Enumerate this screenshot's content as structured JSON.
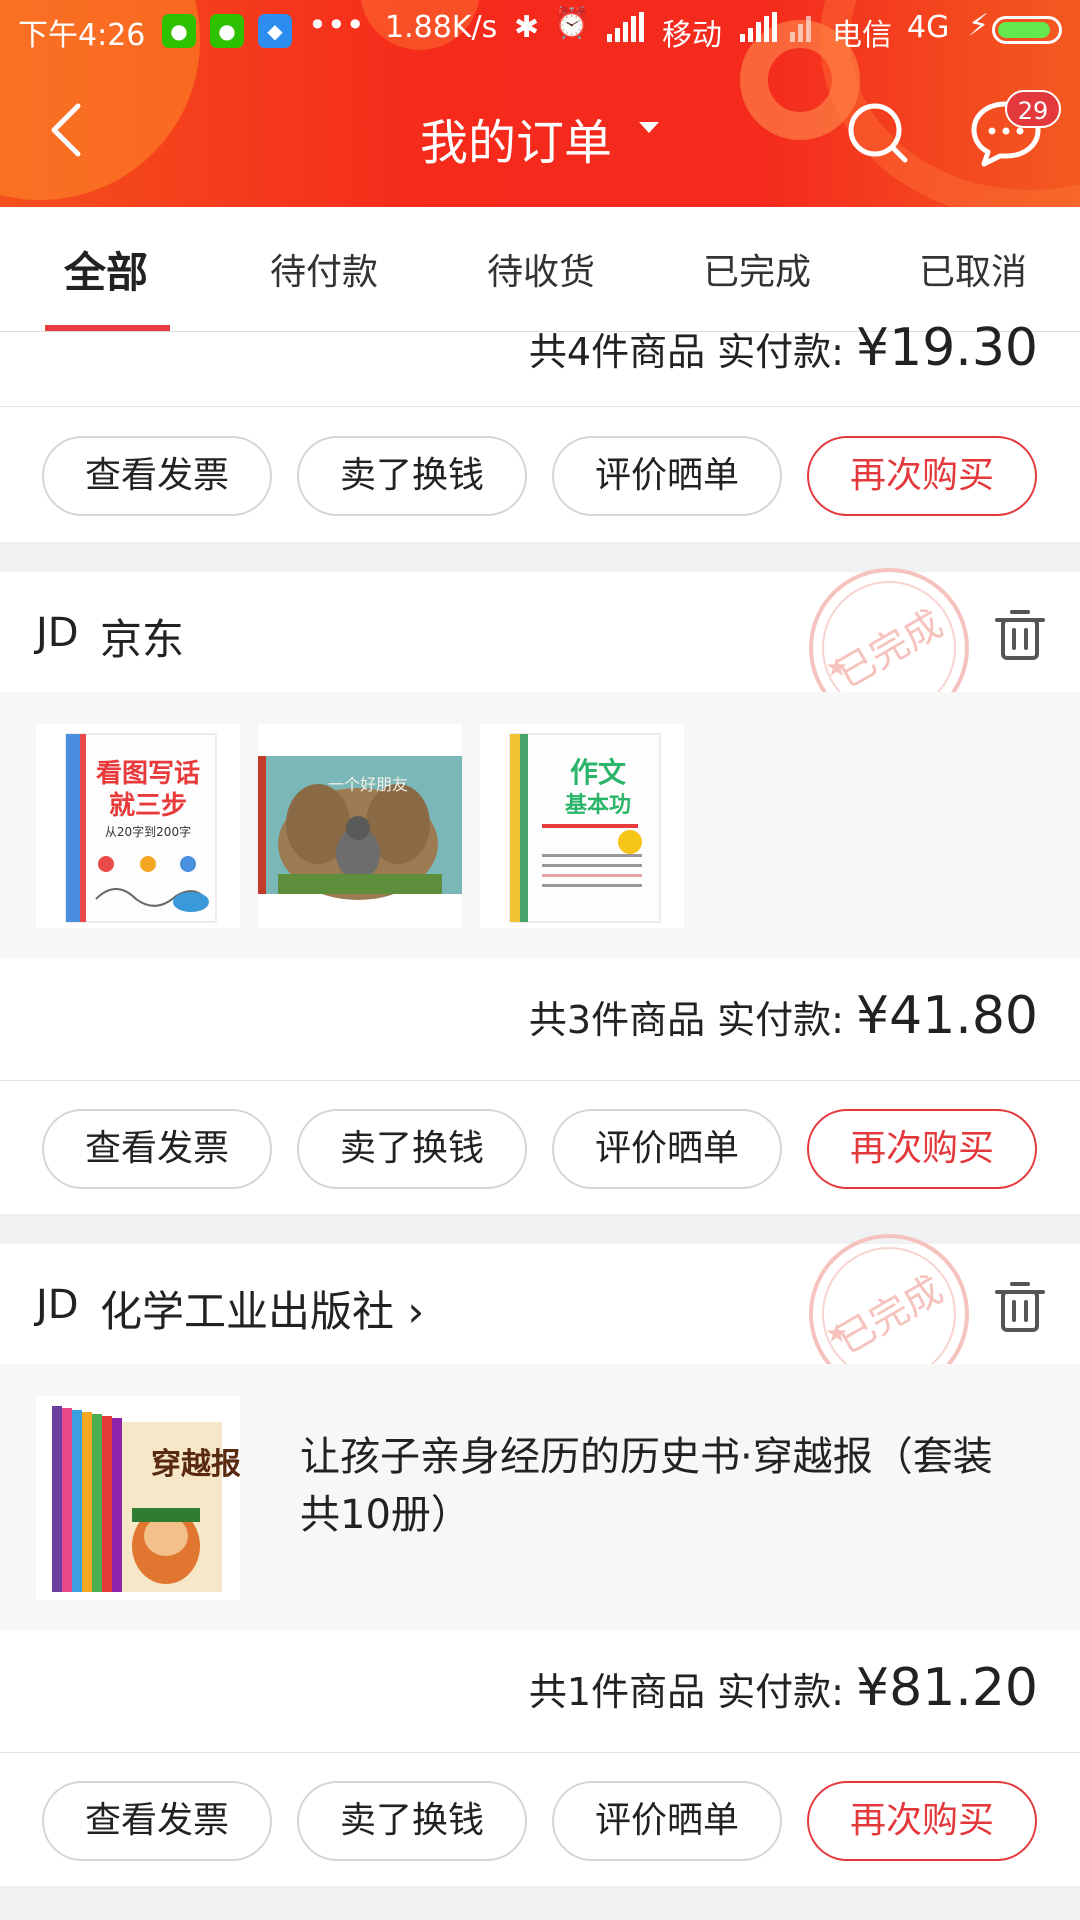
{
  "status_bar": {
    "time": "下午4:26",
    "speed": "1.88K/s",
    "carrier1": "移动",
    "carrier2": "电信",
    "network": "4G",
    "battery_level": 0.9,
    "battery_color": "#63e84e"
  },
  "header": {
    "title": "我的订单",
    "badge_count": "29",
    "accent_color": "#f42a1d"
  },
  "tabs": [
    {
      "label": "全部",
      "active": true
    },
    {
      "label": "待付款",
      "active": false
    },
    {
      "label": "待收货",
      "active": false
    },
    {
      "label": "已完成",
      "active": false
    },
    {
      "label": "已取消",
      "active": false
    }
  ],
  "order_partial": {
    "summary_prefix": "共4件商品  实付款:",
    "amount": "¥19.30"
  },
  "order_buttons": {
    "invoice": "查看发票",
    "sell": "卖了换钱",
    "review": "评价晒单",
    "rebuy": "再次购买"
  },
  "stamp_text": "已完成",
  "orders": [
    {
      "shop_logo": "JD",
      "shop_name": "京东",
      "item_count_label": "共3件商品  实付款:",
      "amount": "¥41.80",
      "products": [
        {
          "cover_text_1": "看图写话",
          "cover_text_2": "就三步",
          "cover_text_3": "从20字到200字"
        },
        {
          "cover_text_1": "一个好朋友"
        },
        {
          "cover_text_1": "作文",
          "cover_text_2": "基本功"
        }
      ]
    },
    {
      "shop_logo": "JD",
      "shop_name": "化学工业出版社",
      "shop_arrow": "›",
      "item_count_label": "共1件商品  实付款:",
      "amount": "¥81.20",
      "product_title": "让孩子亲身经历的历史书·穿越报（套装共10册）",
      "cover_text": "穿越报"
    }
  ]
}
